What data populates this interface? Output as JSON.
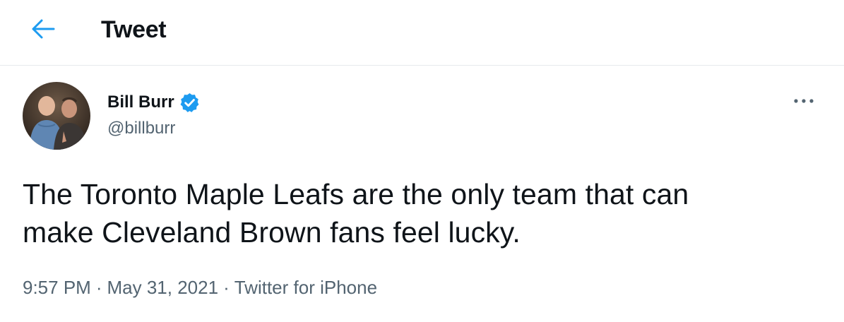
{
  "header": {
    "title": "Tweet",
    "back_icon": "arrow-left-icon",
    "accent": "#1d9bf0"
  },
  "author": {
    "name": "Bill Burr",
    "handle": "@billburr",
    "verified": true,
    "verified_icon": "verified-badge-icon",
    "avatar_icon": "avatar-photo"
  },
  "tweet": {
    "line1": "The Toronto Maple Leafs are the only team that can",
    "line2": "make Cleveland Brown fans feel lucky."
  },
  "meta": {
    "time": "9:57 PM",
    "date": "May 31, 2021",
    "source": "Twitter for iPhone",
    "separator": "·"
  },
  "more_icon": "more-horizontal-icon",
  "colors": {
    "text": "#0f1419",
    "secondary": "#536471",
    "divider": "#e6e9ec"
  }
}
